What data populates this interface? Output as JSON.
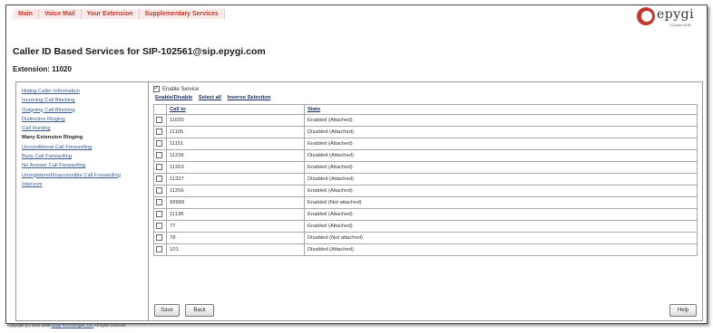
{
  "topnav": [
    "Main",
    "Voice Mail",
    "Your Extension",
    "Supplementary Services"
  ],
  "logo": {
    "brand": "epygi",
    "sub": "TQuadro4HB"
  },
  "page_title": "Caller ID Based Services for SIP-102561@sip.epygi.com",
  "extension_title": "Extension: 11020",
  "sidebar": {
    "items": [
      {
        "label": "Hiding Caller Information",
        "active": false
      },
      {
        "label": "Incoming Call Blocking",
        "active": false
      },
      {
        "label": "Outgoing Call Blocking",
        "active": false
      },
      {
        "label": "Distinctive Ringing",
        "active": false
      },
      {
        "label": "Call Hunting",
        "active": false
      },
      {
        "label": "Many Extension Ringing",
        "active": true
      },
      {
        "label": "Unconditional Call Forwarding",
        "active": false
      },
      {
        "label": "Busy Call Forwarding",
        "active": false
      },
      {
        "label": "No Answer Call Forwarding",
        "active": false
      },
      {
        "label": "Unregistered/Inaccessible Call Forwarding",
        "active": false
      },
      {
        "label": "Intercom",
        "active": false
      }
    ]
  },
  "main": {
    "enable_service_label": "Enable Service",
    "enable_service_checked": true,
    "bulk_links": [
      "Enable/Disable",
      "Select all",
      "Inverse Selection"
    ],
    "columns": [
      "Call to",
      "State"
    ],
    "rows": [
      {
        "call_to": "11020",
        "state": "Enabled (Attached)"
      },
      {
        "call_to": "11105",
        "state": "Disabled (Attached)"
      },
      {
        "call_to": "11151",
        "state": "Enabled (Attached)"
      },
      {
        "call_to": "11236",
        "state": "Disabled (Attached)"
      },
      {
        "call_to": "11263",
        "state": "Enabled (Attached)"
      },
      {
        "call_to": "11327",
        "state": "Disabled (Attached)"
      },
      {
        "call_to": "11256",
        "state": "Enabled (Attached)"
      },
      {
        "call_to": "99999",
        "state": "Enabled (Not attached)"
      },
      {
        "call_to": "11138",
        "state": "Enabled (Attached)"
      },
      {
        "call_to": "77",
        "state": "Enabled (Attached)"
      },
      {
        "call_to": "78",
        "state": "Disabled (Not attached)"
      },
      {
        "call_to": "101",
        "state": "Disabled (Attached)"
      }
    ],
    "save_label": "Save",
    "back_label": "Back",
    "help_label": "Help"
  },
  "footer": {
    "prefix": "Copyright (C) 2003-2008 ",
    "link": "Epygi Technologies, Ltd.",
    "suffix": " All rights reserved"
  },
  "colors": {
    "nav_text": "#c0392b",
    "nav_bg": "#fbeaea",
    "link": "#3b5b8c",
    "brand": "#c0392b"
  }
}
